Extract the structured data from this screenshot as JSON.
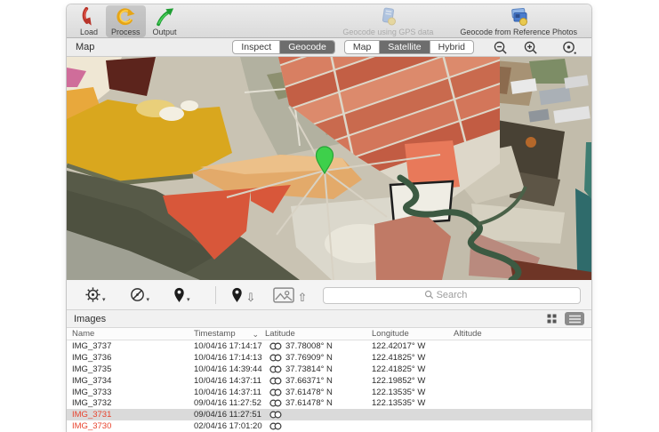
{
  "colors": {
    "accent_red_text": "#e8432d",
    "segment_selected_bg": "#6d6d6d",
    "selected_row_bg": "#dadada",
    "pin_green": "#3ed04b"
  },
  "icons": {
    "sort_chevron": "⌄",
    "dropdown_arrow": "▾",
    "arrow_down_outline": "⇩",
    "arrow_up_outline": "⇧"
  },
  "toolbar": {
    "load_label": "Load",
    "process_label": "Process",
    "output_label": "Output",
    "geocode_gps_label": "Geocode using GPS data",
    "geocode_ref_label": "Geocode from Reference Photos"
  },
  "map_bar": {
    "title": "Map",
    "inspect_label": "Inspect",
    "geocode_label": "Geocode",
    "map_label": "Map",
    "satellite_label": "Satellite",
    "hybrid_label": "Hybrid"
  },
  "map_toolbar": {
    "search_placeholder": "Search"
  },
  "images_panel": {
    "title": "Images",
    "columns": {
      "name": "Name",
      "timestamp": "Timestamp",
      "latitude": "Latitude",
      "longitude": "Longitude",
      "altitude": "Altitude"
    },
    "rows": [
      {
        "name": "IMG_3737",
        "timestamp": "10/04/16 17:14:17",
        "latitude": "37.78008° N",
        "longitude": "122.42017° W",
        "altitude": "",
        "badge": true,
        "missing_gps": false,
        "selected": false
      },
      {
        "name": "IMG_3736",
        "timestamp": "10/04/16 17:14:13",
        "latitude": "37.76909° N",
        "longitude": "122.41825° W",
        "altitude": "",
        "badge": true,
        "missing_gps": false,
        "selected": false
      },
      {
        "name": "IMG_3735",
        "timestamp": "10/04/16 14:39:44",
        "latitude": "37.73814° N",
        "longitude": "122.41825° W",
        "altitude": "",
        "badge": true,
        "missing_gps": false,
        "selected": false
      },
      {
        "name": "IMG_3734",
        "timestamp": "10/04/16 14:37:11",
        "latitude": "37.66371° N",
        "longitude": "122.19852° W",
        "altitude": "",
        "badge": true,
        "missing_gps": false,
        "selected": false
      },
      {
        "name": "IMG_3733",
        "timestamp": "10/04/16 14:37:11",
        "latitude": "37.61478° N",
        "longitude": "122.13535° W",
        "altitude": "",
        "badge": true,
        "missing_gps": false,
        "selected": false
      },
      {
        "name": "IMG_3732",
        "timestamp": "09/04/16 11:27:52",
        "latitude": "37.61478° N",
        "longitude": "122.13535° W",
        "altitude": "",
        "badge": true,
        "missing_gps": false,
        "selected": false
      },
      {
        "name": "IMG_3731",
        "timestamp": "09/04/16 11:27:51",
        "latitude": "",
        "longitude": "",
        "altitude": "",
        "badge": true,
        "missing_gps": true,
        "selected": true
      },
      {
        "name": "IMG_3730",
        "timestamp": "02/04/16 17:01:20",
        "latitude": "",
        "longitude": "",
        "altitude": "",
        "badge": true,
        "missing_gps": true,
        "selected": false
      }
    ]
  }
}
